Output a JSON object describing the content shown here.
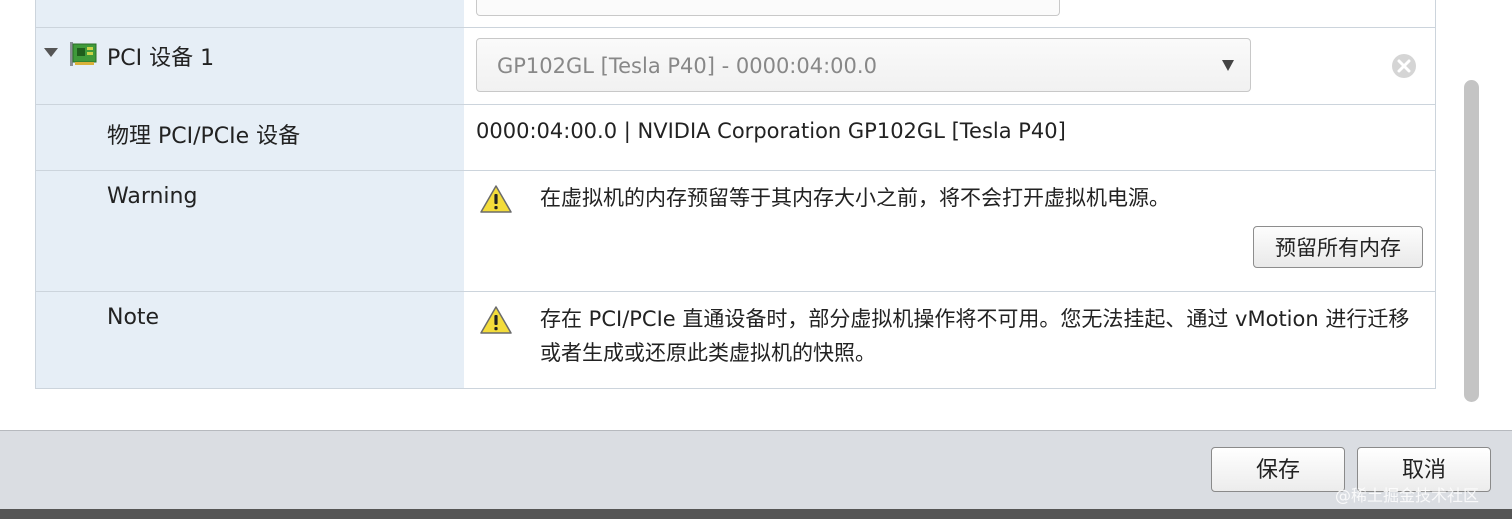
{
  "pci_device": {
    "row_label": "PCI 设备 1",
    "selected_device": "GP102GL [Tesla P40] - 0000:04:00.0",
    "physical_label": "物理 PCI/PCIe 设备",
    "physical_value": "0000:04:00.0 | NVIDIA Corporation GP102GL [Tesla P40]"
  },
  "warning": {
    "label": "Warning",
    "message": "在虚拟机的内存预留等于其内存大小之前，将不会打开虚拟机电源。",
    "button_label": "预留所有内存"
  },
  "note": {
    "label": "Note",
    "message": "存在 PCI/PCIe 直通设备时，部分虚拟机操作将不可用。您无法挂起、通过 vMotion 进行迁移或者生成或还原此类虚拟机的快照。"
  },
  "footer": {
    "save_label": "保存",
    "cancel_label": "取消",
    "watermark": "@稀土掘金技术社区"
  },
  "icons": {
    "expand": "chevron-down-icon",
    "device": "pci-card-icon",
    "select_arrow": "dropdown-arrow-icon",
    "remove": "remove-circle-icon",
    "warning": "warning-triangle-icon"
  },
  "colors": {
    "label_column_bg": "#e6eef6",
    "warning_fill": "#f3dc3b",
    "footer_bg": "#dadde2"
  }
}
